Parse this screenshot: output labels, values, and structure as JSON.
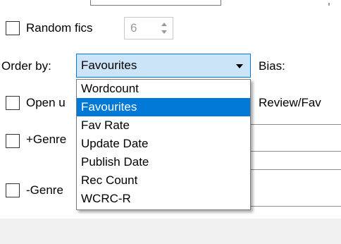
{
  "random_fics": {
    "label": "Random fics",
    "value": "6",
    "checked": false
  },
  "order_by": {
    "label": "Order by:",
    "selected": "Favourites",
    "options": [
      "Wordcount",
      "Favourites",
      "Fav Rate",
      "Update Date",
      "Publish Date",
      "Rec Count",
      "WCRC-R"
    ]
  },
  "bias": {
    "label": "Bias:"
  },
  "open_option": {
    "label": "Open u",
    "checked": false
  },
  "review_fav": {
    "label": "Review/Fav"
  },
  "genre_plus": {
    "label": "+Genre",
    "checked": false
  },
  "genre_minus": {
    "label": "-Genre",
    "checked": false
  },
  "colors": {
    "accent": "#0078d7",
    "combo_bg": "#cce4f7",
    "footer_bg": "#f0f0f0"
  }
}
